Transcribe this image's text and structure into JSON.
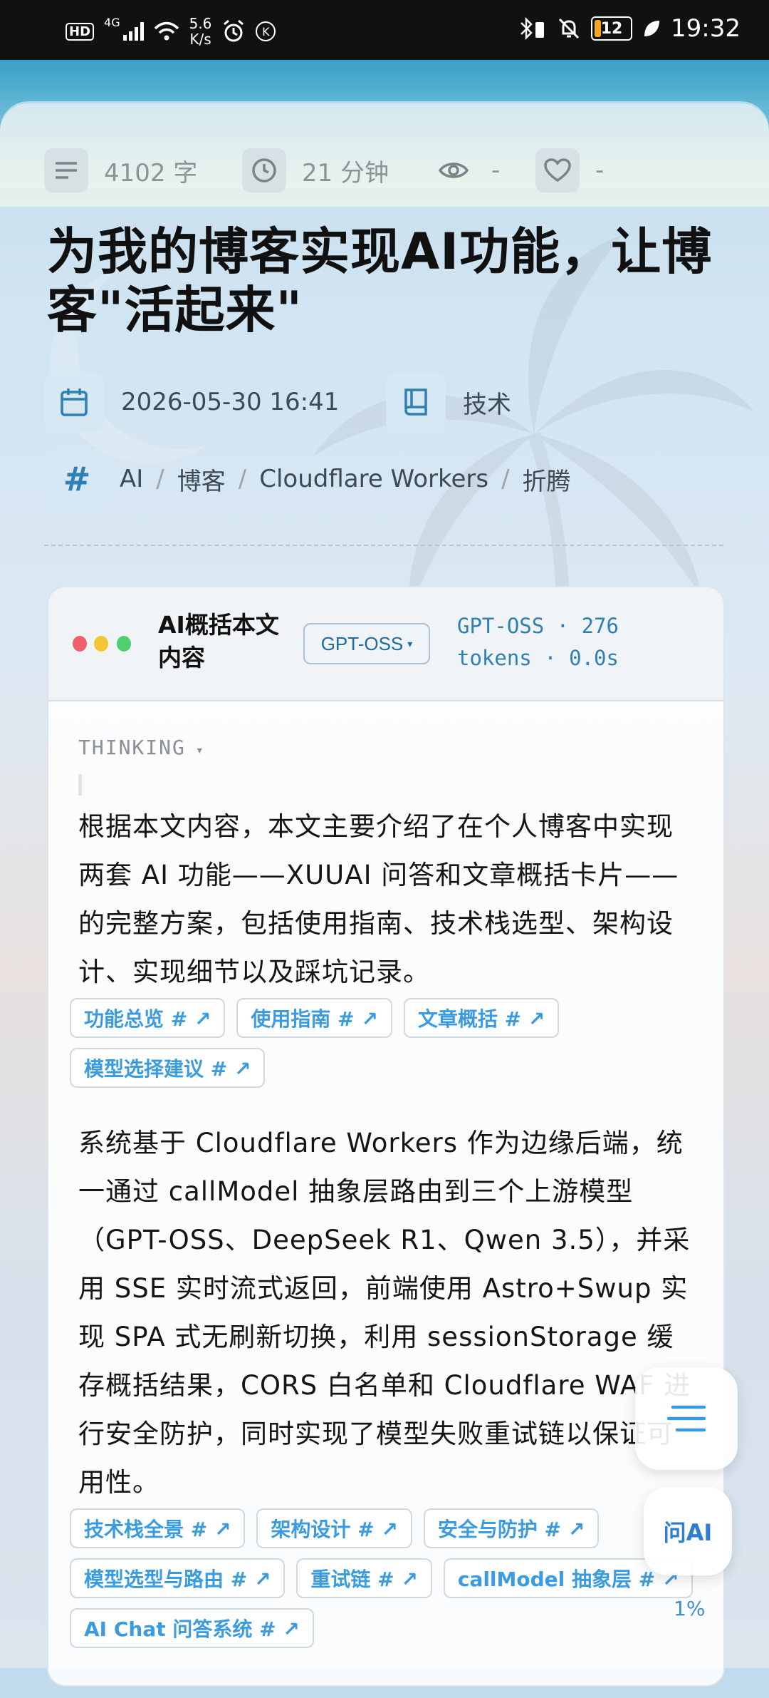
{
  "status_bar": {
    "network": "HD",
    "signal": "4G",
    "speed_value": "5.6",
    "speed_unit": "K/s",
    "k_badge": "K",
    "battery": "12",
    "time": "19:32"
  },
  "stats": {
    "word_count": "4102 字",
    "read_time": "21 分钟",
    "views": "-",
    "likes": "-"
  },
  "article": {
    "title": "为我的博客实现AI功能，让博客\"活起来\"",
    "date": "2026-05-30 16:41",
    "category": "技术",
    "tags": [
      "AI",
      "博客",
      "Cloudflare Workers",
      "折腾"
    ],
    "tag_separator": "/"
  },
  "summary": {
    "title": "AI概括本文内容",
    "model": "GPT-OSS",
    "token_info": "GPT-OSS · 276 tokens · 0.0s",
    "thinking_label": "THINKING",
    "paragraph1": "根据本文内容，本文主要介绍了在个人博客中实现两套 AI 功能——XUUAI 问答和文章概括卡片——的完整方案，包括使用指南、技术栈选型、架构设计、实现细节以及踩坑记录。",
    "chips1": [
      "功能总览 # ↗",
      "使用指南 # ↗",
      "文章概括 # ↗",
      "模型选择建议 # ↗"
    ],
    "paragraph2": "系统基于 Cloudflare Workers 作为边缘后端，统一通过 callModel 抽象层路由到三个上游模型（GPT-OSS、DeepSeek R1、Qwen 3.5），并采用 SSE 实时流式返回，前端使用 Astro+Swup 实现 SPA 式无刷新切换，利用 sessionStorage 缓存概括结果，CORS 白名单和 Cloudflare WAF 进行安全防护，同时实现了模型失败重试链以保证可用性。",
    "chips2": [
      "技术栈全景 # ↗",
      "架构设计 # ↗",
      "安全与防护 # ↗",
      "模型选型与路由 # ↗",
      "重试链 # ↗",
      "callModel 抽象层 # ↗",
      "AI Chat 问答系统 # ↗"
    ]
  },
  "floating": {
    "ask_ai": "问AI",
    "progress": "1%"
  },
  "colors": {
    "accent": "#3a9be0",
    "icon_blue": "#2f7fb3",
    "dot_red": "#f0606a",
    "dot_yellow": "#f3c531",
    "dot_green": "#4fcf70"
  }
}
